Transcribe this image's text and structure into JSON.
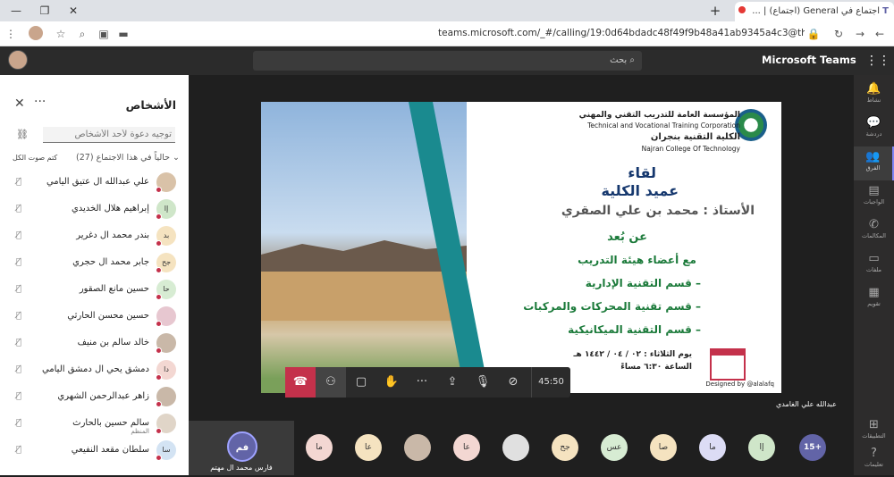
{
  "browser": {
    "tab_title": "اجتماع في General (اجتماع) | ...",
    "url": "teams.microsoft.com/_#/calling/19:0d64bdadc48f49f9b48a41ab9345a4c3@thread.tacv2/"
  },
  "teams": {
    "brand": "Microsoft Teams",
    "search_placeholder": "بحث"
  },
  "rail": [
    {
      "label": "نشاط",
      "icon": "bell-icon"
    },
    {
      "label": "دردشة",
      "icon": "chat-icon"
    },
    {
      "label": "الفرق",
      "icon": "teams-icon"
    },
    {
      "label": "الواجبات",
      "icon": "assignments-icon"
    },
    {
      "label": "المكالمات",
      "icon": "phone-icon"
    },
    {
      "label": "ملفات",
      "icon": "files-icon"
    },
    {
      "label": "تقويم",
      "icon": "calendar-icon"
    },
    {
      "label": "التطبيقات",
      "icon": "apps-icon"
    },
    {
      "label": "تعليمات",
      "icon": "help-icon"
    }
  ],
  "people": {
    "title": "الأشخاص",
    "invite_placeholder": "توجيه دعوة لأحد الأشخاص",
    "section": "حالياً في هذا الاجتماع (27)",
    "mute_all": "كتم صوت الكل",
    "participants": [
      {
        "name": "علي عبدالله ال عتيق اليامي",
        "initials": "",
        "color": "#d9c2a8"
      },
      {
        "name": "إبراهيم هلال الخديدي",
        "initials": "إا",
        "color": "#cfe6c9"
      },
      {
        "name": "بندر محمد ال دغرير",
        "initials": "بد",
        "color": "#f5e3c0"
      },
      {
        "name": "جابر محمد ال حجري",
        "initials": "جح",
        "color": "#f5e3c0"
      },
      {
        "name": "حسين مانع الصقور",
        "initials": "حا",
        "color": "#d7ecd3"
      },
      {
        "name": "حسين محسن الحارثي",
        "initials": "",
        "color": "#e7c7d0"
      },
      {
        "name": "خالد سالم بن منيف",
        "initials": "",
        "color": "#c9b8a8"
      },
      {
        "name": "دمشق يحي ال دمشق اليامي",
        "initials": "دا",
        "color": "#f3d7d2"
      },
      {
        "name": "زاهر عبدالرحمن الشهري",
        "initials": "",
        "color": "#c9b8a8"
      },
      {
        "name": "سالم حسين بالحارث",
        "sub": "المنظم",
        "initials": "",
        "color": "#e0d5c8"
      },
      {
        "name": "سلطان مقعد النفيعي",
        "initials": "سا",
        "color": "#d3e3f3"
      }
    ]
  },
  "slide": {
    "org_ar": "المؤسسة العامة للتدريب التقني والمهني",
    "org_en": "Technical and Vocational Training Corporation",
    "college_ar": "الكلية التقنية بنجران",
    "college_en": "Najran College Of Technology",
    "line1": "لقاء",
    "line2": "عميد الكلية",
    "line3": "الأستاذ : محمد بن علي الصقري",
    "line4": "عن بُعد",
    "line5": "مع أعضاء هيئة التدريب",
    "line6": "– قسم التقنية الإدارية",
    "line7": "– قسم تقنية المحركات والمركبات",
    "line8": "– قسم التقنية الميكانيكية",
    "date": "يوم الثلاثاء : ٠٢ / ٠٤ / ١٤٤٢ هـ",
    "time": "الساعة ٦:٣٠ مساءً",
    "designed_by": "Designed by @alalafq"
  },
  "call": {
    "timer": "45:50",
    "presenter": "عبدالله علي الغامدي",
    "self_initials": "فم",
    "self_name": "فارس محمد ال مهتم",
    "more_count": "15+"
  },
  "gallery": [
    {
      "initials": "ما",
      "color": "#f3d7d2"
    },
    {
      "initials": "عا",
      "color": "#f5e3c0"
    },
    {
      "initials": "",
      "color": "#c9b8a8"
    },
    {
      "initials": "عا",
      "color": "#f3d7d2"
    },
    {
      "initials": "",
      "color": "#e0e0e0"
    },
    {
      "initials": "جح",
      "color": "#f5e3c0"
    },
    {
      "initials": "عس",
      "color": "#d7ecd3"
    },
    {
      "initials": "صا",
      "color": "#f5e3c0"
    },
    {
      "initials": "ما",
      "color": "#dcdcf5"
    },
    {
      "initials": "إا",
      "color": "#cfe6c9"
    }
  ]
}
